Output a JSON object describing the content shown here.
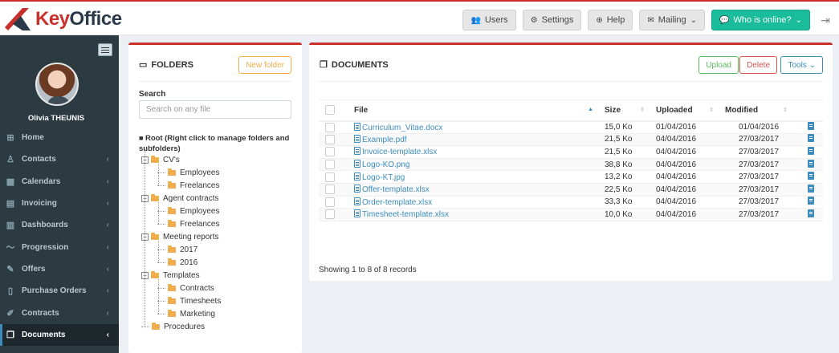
{
  "app": {
    "logo_text_k": "Key",
    "logo_text_o": "Office",
    "brand_color": "#c9302c"
  },
  "topnav": {
    "users": "Users",
    "settings": "Settings",
    "help": "Help",
    "mailing": "Mailing",
    "online": "Who is online?"
  },
  "sidebar": {
    "user_name": "Olivia THEUNIS",
    "items": [
      {
        "label": "Home",
        "icon": "grid-icon",
        "glyph": "⊞",
        "chevron": false
      },
      {
        "label": "Contacts",
        "icon": "contacts-icon",
        "glyph": "♙",
        "chevron": true
      },
      {
        "label": "Calendars",
        "icon": "calendar-icon",
        "glyph": "▦",
        "chevron": true
      },
      {
        "label": "Invoicing",
        "icon": "invoice-icon",
        "glyph": "▤",
        "chevron": true
      },
      {
        "label": "Dashboards",
        "icon": "bar-chart-icon",
        "glyph": "▥",
        "chevron": true
      },
      {
        "label": "Progression",
        "icon": "trend-icon",
        "glyph": "〜",
        "chevron": true
      },
      {
        "label": "Offers",
        "icon": "tag-icon",
        "glyph": "✎",
        "chevron": true
      },
      {
        "label": "Purchase Orders",
        "icon": "document-icon",
        "glyph": "▯",
        "chevron": true
      },
      {
        "label": "Contracts",
        "icon": "pen-icon",
        "glyph": "✐",
        "chevron": true
      },
      {
        "label": "Documents",
        "icon": "documents-icon",
        "glyph": "❐",
        "chevron": true
      }
    ]
  },
  "folders": {
    "title": "FOLDERS",
    "new_folder": "New folder",
    "search_label": "Search",
    "search_placeholder": "Search on any file",
    "root_label": "Root",
    "root_hint": "(Right click to manage folders and subfolders)",
    "tree": [
      {
        "label": "CV's",
        "level": 1,
        "toggle": "−"
      },
      {
        "label": "Employees",
        "level": 2
      },
      {
        "label": "Freelances",
        "level": 2
      },
      {
        "label": "Agent contracts",
        "level": 1,
        "toggle": "−"
      },
      {
        "label": "Employees",
        "level": 2
      },
      {
        "label": "Freelances",
        "level": 2
      },
      {
        "label": "Meeting reports",
        "level": 1,
        "toggle": "−"
      },
      {
        "label": "2017",
        "level": 2
      },
      {
        "label": "2016",
        "level": 2
      },
      {
        "label": "Templates",
        "level": 1,
        "toggle": "−"
      },
      {
        "label": "Contracts",
        "level": 2
      },
      {
        "label": "Timesheets",
        "level": 2
      },
      {
        "label": "Marketing",
        "level": 2
      },
      {
        "label": "Procedures",
        "level": 1
      }
    ]
  },
  "documents": {
    "title": "DOCUMENTS",
    "upload": "Upload",
    "delete": "Delete",
    "tools": "Tools",
    "columns": {
      "file": "File",
      "size": "Size",
      "uploaded": "Uploaded",
      "modified": "Modified"
    },
    "rows": [
      {
        "file": "Curriculum_Vitae.docx",
        "size": "15,0 Ko",
        "uploaded": "01/04/2016",
        "modified": "01/04/2016"
      },
      {
        "file": "Example.pdf",
        "size": "21,5 Ko",
        "uploaded": "04/04/2016",
        "modified": "27/03/2017"
      },
      {
        "file": "Invoice-template.xlsx",
        "size": "21,5 Ko",
        "uploaded": "04/04/2016",
        "modified": "27/03/2017"
      },
      {
        "file": "Logo-KO.png",
        "size": "38,8 Ko",
        "uploaded": "04/04/2016",
        "modified": "27/03/2017"
      },
      {
        "file": "Logo-KT.jpg",
        "size": "13,2 Ko",
        "uploaded": "04/04/2016",
        "modified": "27/03/2017"
      },
      {
        "file": "Offer-template.xlsx",
        "size": "22,5 Ko",
        "uploaded": "04/04/2016",
        "modified": "27/03/2017"
      },
      {
        "file": "Order-template.xlsx",
        "size": "33,3 Ko",
        "uploaded": "04/04/2016",
        "modified": "27/03/2017"
      },
      {
        "file": "Timesheet-template.xlsx",
        "size": "10,0 Ko",
        "uploaded": "04/04/2016",
        "modified": "27/03/2017"
      }
    ],
    "showing": "Showing 1 to 8 of 8 records"
  }
}
